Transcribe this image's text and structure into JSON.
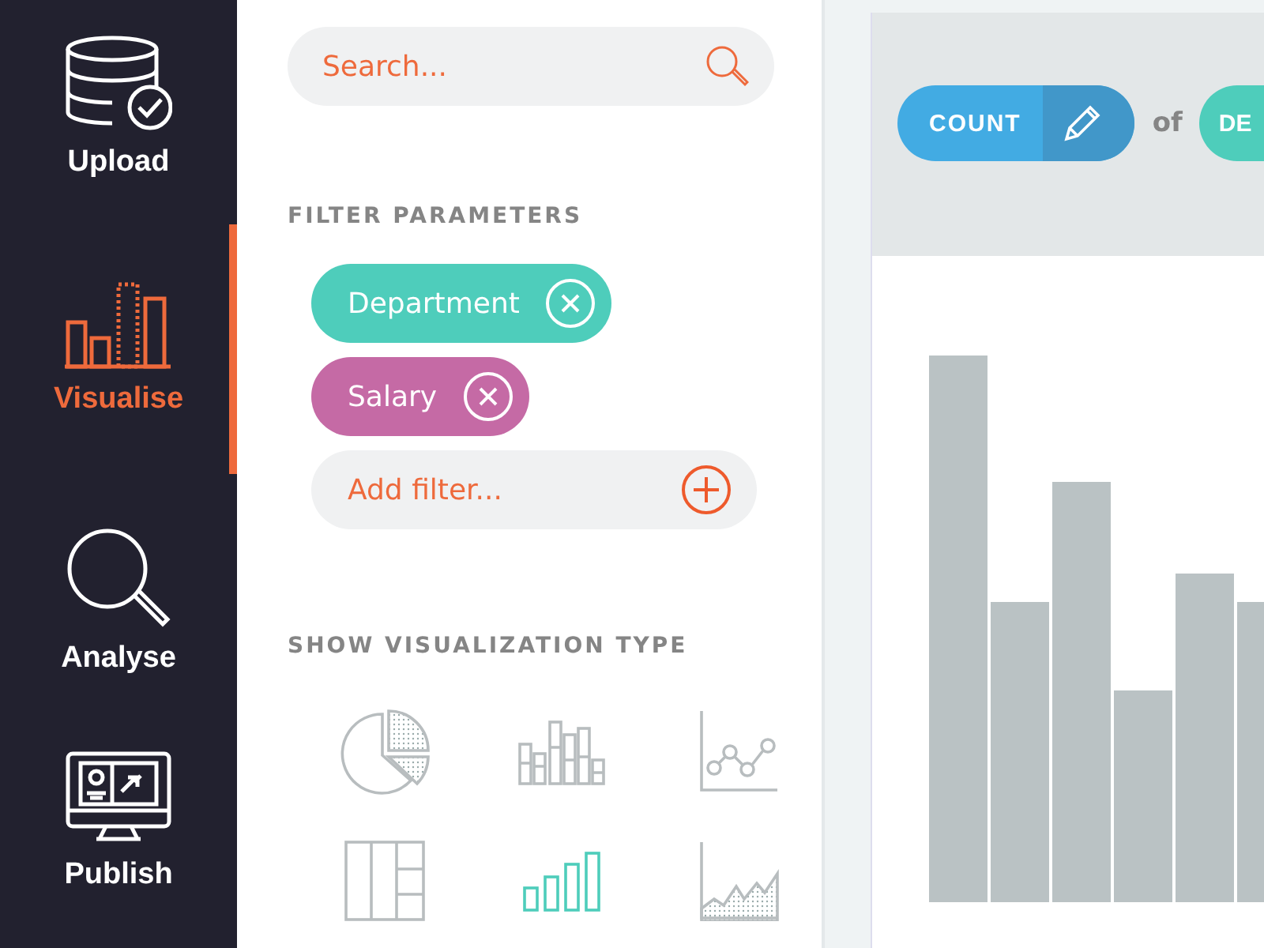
{
  "nav": [
    {
      "label": "Upload",
      "kind": "upload",
      "selected": false
    },
    {
      "label": "Visualise",
      "kind": "visualise",
      "selected": true
    },
    {
      "label": "Analyse",
      "kind": "analyse",
      "selected": false
    },
    {
      "label": "Publish",
      "kind": "publish",
      "selected": false
    }
  ],
  "search": {
    "placeholder": "Search..."
  },
  "filter_heading": "FILTER PARAMETERS",
  "filters": [
    {
      "label": "Department",
      "color": "#4ecdbb"
    },
    {
      "label": "Salary",
      "color": "#c56aa5"
    }
  ],
  "add_filter": {
    "placeholder": "Add filter..."
  },
  "viz_heading": "SHOW VISUALIZATION TYPE",
  "viz_types": [
    {
      "kind": "pie",
      "selected": false
    },
    {
      "kind": "grouped-bar",
      "selected": false
    },
    {
      "kind": "line",
      "selected": false
    },
    {
      "kind": "table",
      "selected": false
    },
    {
      "kind": "bar",
      "selected": true
    },
    {
      "kind": "area",
      "selected": false
    }
  ],
  "query": {
    "measure": "COUNT",
    "joiner": "of",
    "dimension": "DE"
  }
}
